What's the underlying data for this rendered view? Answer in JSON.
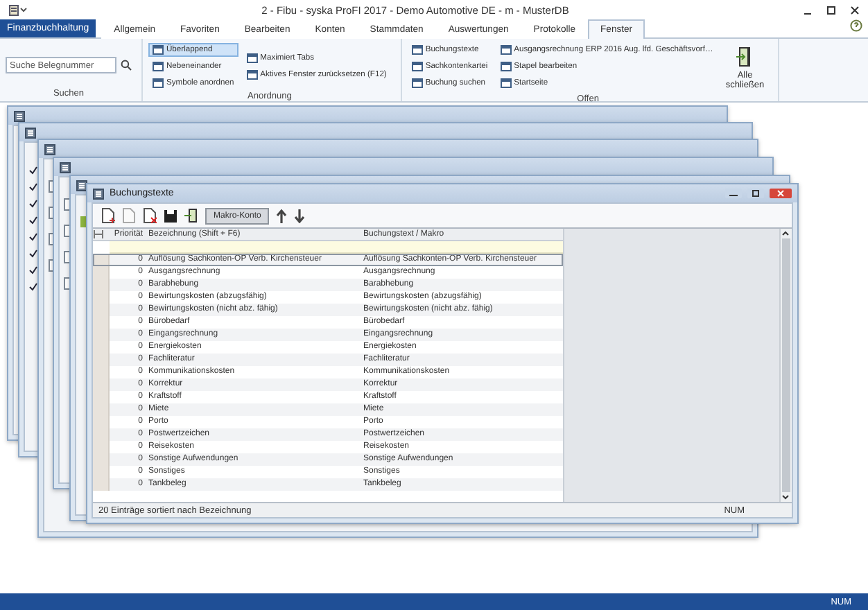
{
  "window": {
    "title": "2 - Fibu - syska ProFI 2017 - Demo Automotive DE - m - MusterDB"
  },
  "app_menu": {
    "label": "Finanzbuchhaltung"
  },
  "tabs": [
    {
      "label": "Allgemein",
      "selected": false
    },
    {
      "label": "Favoriten",
      "selected": false
    },
    {
      "label": "Bearbeiten",
      "selected": false
    },
    {
      "label": "Konten",
      "selected": false
    },
    {
      "label": "Stammdaten",
      "selected": false
    },
    {
      "label": "Auswertungen",
      "selected": false
    },
    {
      "label": "Protokolle",
      "selected": false
    },
    {
      "label": "Fenster",
      "selected": true
    }
  ],
  "ribbon": {
    "search": {
      "placeholder": "Suche Belegnummer",
      "group": "Suchen"
    },
    "arrange": {
      "group": "Anordnung",
      "columns": [
        [
          {
            "label": "Überlappend",
            "selected": true
          },
          {
            "label": "Nebeneinander",
            "selected": false
          },
          {
            "label": "Symbole anordnen",
            "selected": false
          }
        ],
        [
          {
            "label": "Maximiert Tabs",
            "selected": false
          },
          {
            "label": "Aktives Fenster zurücksetzen (F12)",
            "selected": false
          }
        ]
      ]
    },
    "open": {
      "group": "Offen",
      "columns": [
        [
          "Buchungstexte",
          "Sachkontenkartei",
          "Buchung suchen"
        ],
        [
          "Ausgangsrechnung ERP 2016 Aug. lfd. Geschäftsvorf…",
          "Stapel bearbeiten",
          "Startseite"
        ]
      ]
    },
    "close_all": {
      "label": "Alle schließen"
    }
  },
  "background_windows": [
    {
      "kind": "window"
    },
    {
      "kind": "checklist"
    },
    {
      "kind": "form"
    },
    {
      "kind": "form"
    },
    {
      "kind": "list"
    }
  ],
  "active_window": {
    "title": "Buchungstexte",
    "toolbar_button": "Makro-Konto",
    "columns": [
      "Priorität",
      "Bezeichnung (Shift + F6)",
      "Buchungstext / Makro"
    ],
    "rows": [
      {
        "priority": "0",
        "name": "Auflösung Sachkonten-OP Verb. Kirchensteuer",
        "text": "Auflösung Sachkonten-OP Verb. Kirchensteuer",
        "selected": true
      },
      {
        "priority": "0",
        "name": "Ausgangsrechnung",
        "text": "Ausgangsrechnung",
        "selected": false
      },
      {
        "priority": "0",
        "name": "Barabhebung",
        "text": "Barabhebung",
        "selected": false
      },
      {
        "priority": "0",
        "name": "Bewirtungskosten (abzugsfähig)",
        "text": "Bewirtungskosten (abzugsfähig)",
        "selected": false
      },
      {
        "priority": "0",
        "name": "Bewirtungskosten (nicht abz. fähig)",
        "text": "Bewirtungskosten (nicht abz. fähig)",
        "selected": false
      },
      {
        "priority": "0",
        "name": "Bürobedarf",
        "text": "Bürobedarf",
        "selected": false
      },
      {
        "priority": "0",
        "name": "Eingangsrechnung",
        "text": "Eingangsrechnung",
        "selected": false
      },
      {
        "priority": "0",
        "name": "Energiekosten",
        "text": "Energiekosten",
        "selected": false
      },
      {
        "priority": "0",
        "name": "Fachliteratur",
        "text": "Fachliteratur",
        "selected": false
      },
      {
        "priority": "0",
        "name": "Kommunikationskosten",
        "text": "Kommunikationskosten",
        "selected": false
      },
      {
        "priority": "0",
        "name": "Korrektur",
        "text": "Korrektur",
        "selected": false
      },
      {
        "priority": "0",
        "name": "Kraftstoff",
        "text": "Kraftstoff",
        "selected": false
      },
      {
        "priority": "0",
        "name": "Miete",
        "text": "Miete",
        "selected": false
      },
      {
        "priority": "0",
        "name": "Porto",
        "text": "Porto",
        "selected": false
      },
      {
        "priority": "0",
        "name": "Postwertzeichen",
        "text": "Postwertzeichen",
        "selected": false
      },
      {
        "priority": "0",
        "name": "Reisekosten",
        "text": "Reisekosten",
        "selected": false
      },
      {
        "priority": "0",
        "name": "Sonstige Aufwendungen",
        "text": "Sonstige Aufwendungen",
        "selected": false
      },
      {
        "priority": "0",
        "name": "Sonstiges",
        "text": "Sonstiges",
        "selected": false
      },
      {
        "priority": "0",
        "name": "Tankbeleg",
        "text": "Tankbeleg",
        "selected": false
      }
    ],
    "status": "20 Einträge sortiert nach Bezeichnung",
    "status_indicator": "NUM"
  },
  "status_bar": {
    "indicator": "NUM"
  }
}
